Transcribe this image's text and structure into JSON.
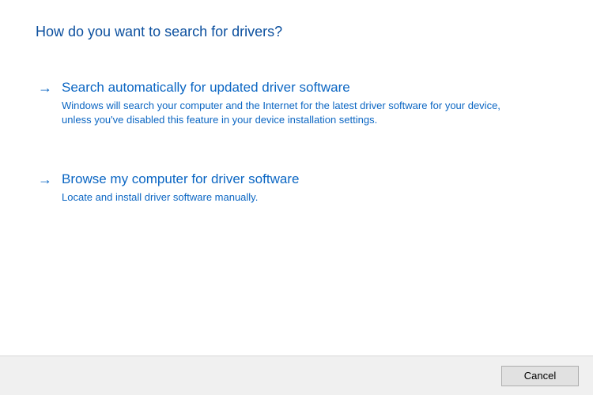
{
  "dialog": {
    "title": "How do you want to search for drivers?",
    "options": {
      "auto": {
        "title": "Search automatically for updated driver software",
        "description": "Windows will search your computer and the Internet for the latest driver software for your device, unless you've disabled this feature in your device installation settings."
      },
      "browse": {
        "title": "Browse my computer for driver software",
        "description": "Locate and install driver software manually."
      }
    },
    "footer": {
      "cancel_label": "Cancel"
    }
  }
}
